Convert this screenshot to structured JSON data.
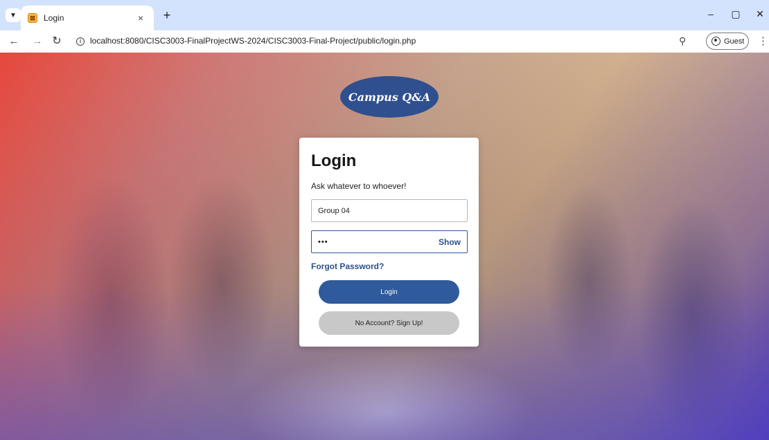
{
  "browser": {
    "tab_title": "Login",
    "favicon_letter": "⊠",
    "new_tab": "+",
    "close_tab": "×",
    "url": "localhost:8080/CISC3003-FinalProjectWS-2024/CISC3003-Final-Project/public/login.php",
    "profile_label": "Guest",
    "icons": {
      "back": "back-arrow-icon",
      "forward": "forward-arrow-icon",
      "reload": "reload-icon",
      "site_info": "info-icon",
      "zoom": "zoom-icon",
      "menu": "kebab-menu-icon"
    },
    "window_controls": [
      "–",
      "▢",
      "✕"
    ]
  },
  "page": {
    "logo_text": "Campus Q&A",
    "login": {
      "title": "Login",
      "subtitle": "Ask whatever to whoever!",
      "username_value": "Group 04",
      "password_value": "•••",
      "show_label": "Show",
      "forgot_label": "Forgot Password?",
      "login_button": "Login",
      "signup_button": "No Account? Sign Up!"
    },
    "colors": {
      "primary": "#2f5a9c",
      "logo_bg": "#2f4f8f",
      "secondary_button": "#c8c8c8",
      "gradient_red": "#e94037",
      "gradient_blue": "#3c28c8"
    }
  }
}
